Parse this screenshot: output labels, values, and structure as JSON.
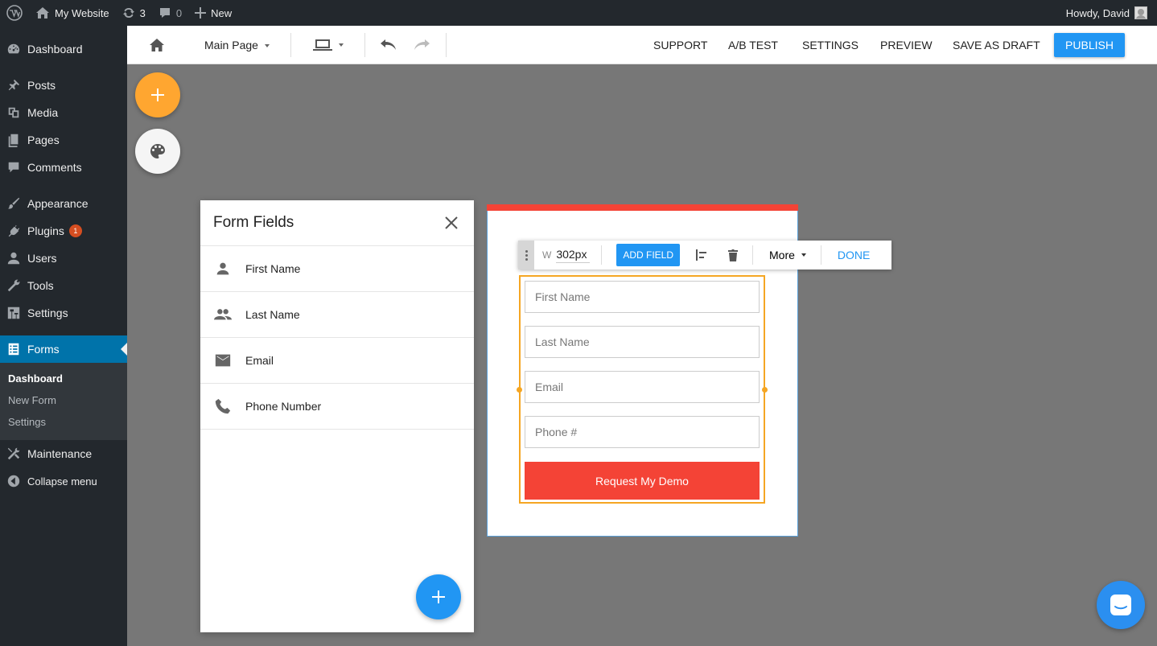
{
  "adminbar": {
    "site_name": "My Website",
    "updates_count": "3",
    "comments_count": "0",
    "new_label": "New",
    "greeting": "Howdy, David"
  },
  "sidebar": {
    "items": [
      {
        "label": "Dashboard",
        "icon": "dashboard-icon"
      },
      {
        "label": "Posts",
        "icon": "pin-icon"
      },
      {
        "label": "Media",
        "icon": "media-icon"
      },
      {
        "label": "Pages",
        "icon": "pages-icon"
      },
      {
        "label": "Comments",
        "icon": "comment-icon"
      },
      {
        "label": "Appearance",
        "icon": "brush-icon"
      },
      {
        "label": "Plugins",
        "icon": "plug-icon",
        "badge": "1"
      },
      {
        "label": "Users",
        "icon": "user-icon"
      },
      {
        "label": "Tools",
        "icon": "wrench-icon"
      },
      {
        "label": "Settings",
        "icon": "settings-icon"
      },
      {
        "label": "Forms",
        "icon": "forms-icon"
      },
      {
        "label": "Maintenance",
        "icon": "maintenance-icon"
      }
    ],
    "submenu": [
      "Dashboard",
      "New Form",
      "Settings"
    ],
    "collapse_label": "Collapse menu",
    "active_color": "#0073aa"
  },
  "toolbar": {
    "page_select": "Main Page",
    "links": [
      "SUPPORT",
      "A/B TEST",
      "SETTINGS",
      "PREVIEW",
      "SAVE AS DRAFT"
    ],
    "publish_label": "PUBLISH",
    "accent": "#2196f3"
  },
  "panel": {
    "title": "Form Fields",
    "fields": [
      {
        "label": "First Name",
        "icon": "person-icon"
      },
      {
        "label": "Last Name",
        "icon": "people-icon"
      },
      {
        "label": "Email",
        "icon": "mail-icon"
      },
      {
        "label": "Phone Number",
        "icon": "phone-icon"
      }
    ]
  },
  "element_toolbar": {
    "width_label": "W",
    "width_value": "302px",
    "add_field_label": "ADD FIELD",
    "more_label": "More",
    "done_label": "DONE"
  },
  "form": {
    "placeholders": [
      "First Name",
      "Last Name",
      "Email",
      "Phone #"
    ],
    "submit_label": "Request My Demo",
    "submit_color": "#f44336"
  }
}
